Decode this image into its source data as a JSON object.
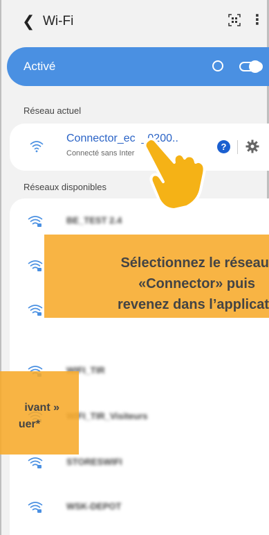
{
  "header": {
    "back_icon": "chevron-left-icon",
    "title": "Wi-Fi",
    "qr_icon": "qr-scan-icon",
    "menu_icon": "more-vertical-icon"
  },
  "wifi_toggle": {
    "label": "Activé",
    "state": "on"
  },
  "current_network": {
    "section_label": "Réseau actuel",
    "name": "Connector_ec  _0200..",
    "status": "Connecté sans Inter",
    "help_label": "?",
    "settings_icon": "gear-icon"
  },
  "available_networks": {
    "section_label": "Réseaux disponibles",
    "items": [
      {
        "name": "BE_TEST 2.4"
      },
      {
        "name": ""
      },
      {
        "name": ""
      },
      {
        "name": "WIFI_TIR"
      },
      {
        "name": "WIFI_TIR_Visiteurs"
      },
      {
        "name": "STORESWIFI"
      },
      {
        "name": "WSK-DEPOT"
      }
    ]
  },
  "overlay_right": {
    "line1": "Sélectionnez le réseau",
    "line2": "«Connector» puis",
    "line3": "revenez dans l’applicat"
  },
  "overlay_left": {
    "line1": "ivant »",
    "line2": "uer*"
  },
  "colors": {
    "accent_blue": "#4a90e2",
    "link_blue": "#2a63c6",
    "overlay_orange": "#f7aa2a",
    "hand_yellow": "#f5b216"
  }
}
